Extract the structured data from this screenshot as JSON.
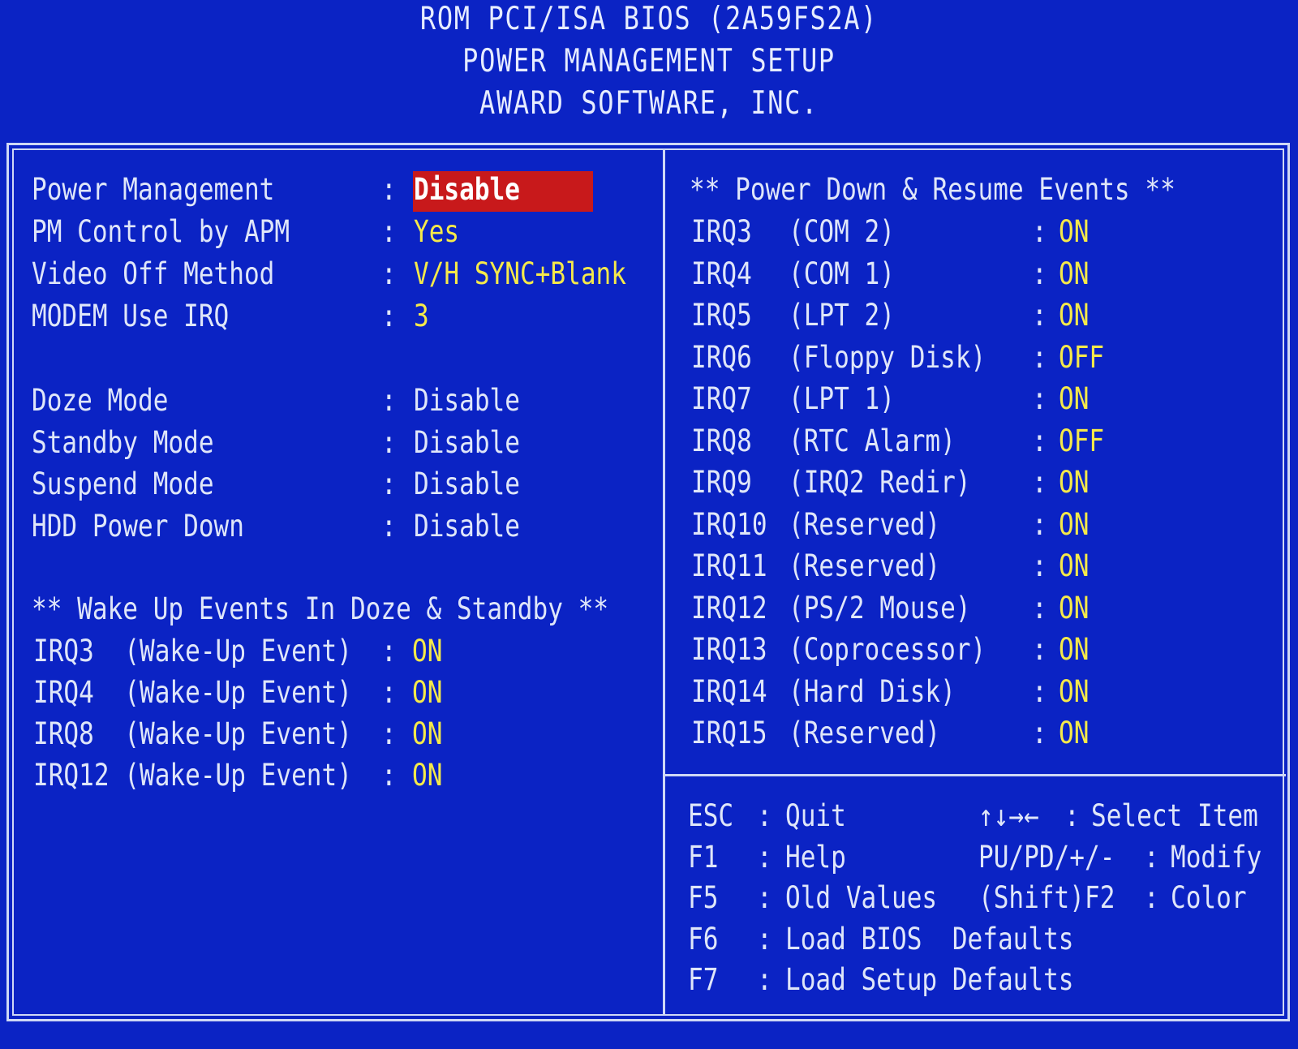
{
  "header": {
    "line1": "ROM PCI/ISA BIOS (2A59FS2A)",
    "line2": "POWER MANAGEMENT SETUP",
    "line3": "AWARD SOFTWARE, INC."
  },
  "left": {
    "settings": [
      {
        "label": "Power Management",
        "value": "Disable",
        "selected": true
      },
      {
        "label": "PM Control by APM",
        "value": "Yes"
      },
      {
        "label": "Video Off Method",
        "value": "V/H SYNC+Blank"
      },
      {
        "label": "MODEM Use IRQ",
        "value": "3"
      }
    ],
    "modes": [
      {
        "label": "Doze Mode",
        "value": "Disable"
      },
      {
        "label": "Standby Mode",
        "value": "Disable"
      },
      {
        "label": "Suspend Mode",
        "value": "Disable"
      },
      {
        "label": "HDD Power Down",
        "value": "Disable"
      }
    ],
    "wake_title": "** Wake Up Events In Doze & Standby **",
    "wake": [
      {
        "label": "IRQ3  (Wake-Up Event)",
        "value": "ON"
      },
      {
        "label": "IRQ4  (Wake-Up Event)",
        "value": "ON"
      },
      {
        "label": "IRQ8  (Wake-Up Event)",
        "value": "ON"
      },
      {
        "label": "IRQ12 (Wake-Up Event)",
        "value": "ON"
      }
    ]
  },
  "right": {
    "title": "** Power Down & Resume Events **",
    "events": [
      {
        "irq": "IRQ3",
        "desc": "(COM 2)",
        "value": "ON"
      },
      {
        "irq": "IRQ4",
        "desc": "(COM 1)",
        "value": "ON"
      },
      {
        "irq": "IRQ5",
        "desc": "(LPT 2)",
        "value": "ON"
      },
      {
        "irq": "IRQ6",
        "desc": "(Floppy Disk)",
        "value": "OFF"
      },
      {
        "irq": "IRQ7",
        "desc": "(LPT 1)",
        "value": "ON"
      },
      {
        "irq": "IRQ8",
        "desc": "(RTC Alarm)",
        "value": "OFF"
      },
      {
        "irq": "IRQ9",
        "desc": "(IRQ2 Redir)",
        "value": "ON"
      },
      {
        "irq": "IRQ10",
        "desc": "(Reserved)",
        "value": "ON"
      },
      {
        "irq": "IRQ11",
        "desc": "(Reserved)",
        "value": "ON"
      },
      {
        "irq": "IRQ12",
        "desc": "(PS/2 Mouse)",
        "value": "ON"
      },
      {
        "irq": "IRQ13",
        "desc": "(Coprocessor)",
        "value": "ON"
      },
      {
        "irq": "IRQ14",
        "desc": "(Hard Disk)",
        "value": "ON"
      },
      {
        "irq": "IRQ15",
        "desc": "(Reserved)",
        "value": "ON"
      }
    ]
  },
  "help": {
    "keys": [
      {
        "key": "ESC",
        "action": "Quit"
      },
      {
        "key": "F1",
        "action": "Help"
      },
      {
        "key": "F5",
        "action": "Old Values"
      },
      {
        "key": "F6",
        "action": "Load BIOS  Defaults"
      },
      {
        "key": "F7",
        "action": "Load Setup Defaults"
      }
    ],
    "right_keys": [
      {
        "key": "↑↓→←",
        "action": "Select Item"
      },
      {
        "key": "PU/PD/+/-",
        "action": "Modify"
      },
      {
        "key": "(Shift)F2",
        "action": "Color"
      }
    ]
  },
  "colors": {
    "background": "#0b23c4",
    "highlight": "#c8191b",
    "value_yellow": "#f5e94a",
    "text_white": "#dfe6f9"
  }
}
